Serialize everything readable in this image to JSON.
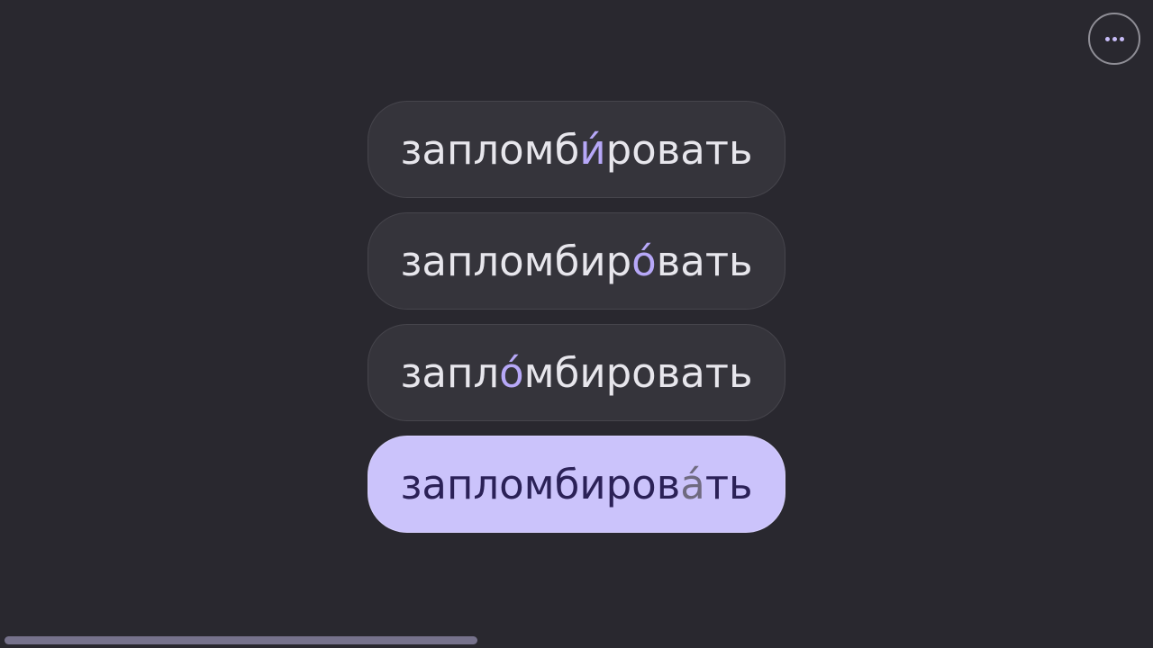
{
  "menu": {
    "icon": "more-horizontal-icon"
  },
  "colors": {
    "background": "#29282f",
    "option_bg": "#35343b",
    "selected_bg": "#cbc3fb",
    "accent": "#b7a8f8",
    "progress": "#76728c"
  },
  "options": [
    {
      "before": "запломб",
      "stress": "и́",
      "after": "ровать",
      "selected": false
    },
    {
      "before": "запломбир",
      "stress": "о́",
      "after": "вать",
      "selected": false
    },
    {
      "before": "запл",
      "stress": "о́",
      "after": "мбировать",
      "selected": false
    },
    {
      "before": "запломбиров",
      "stress": "а́",
      "after": "ть",
      "selected": true
    }
  ],
  "progress": {
    "fraction": 0.41
  }
}
